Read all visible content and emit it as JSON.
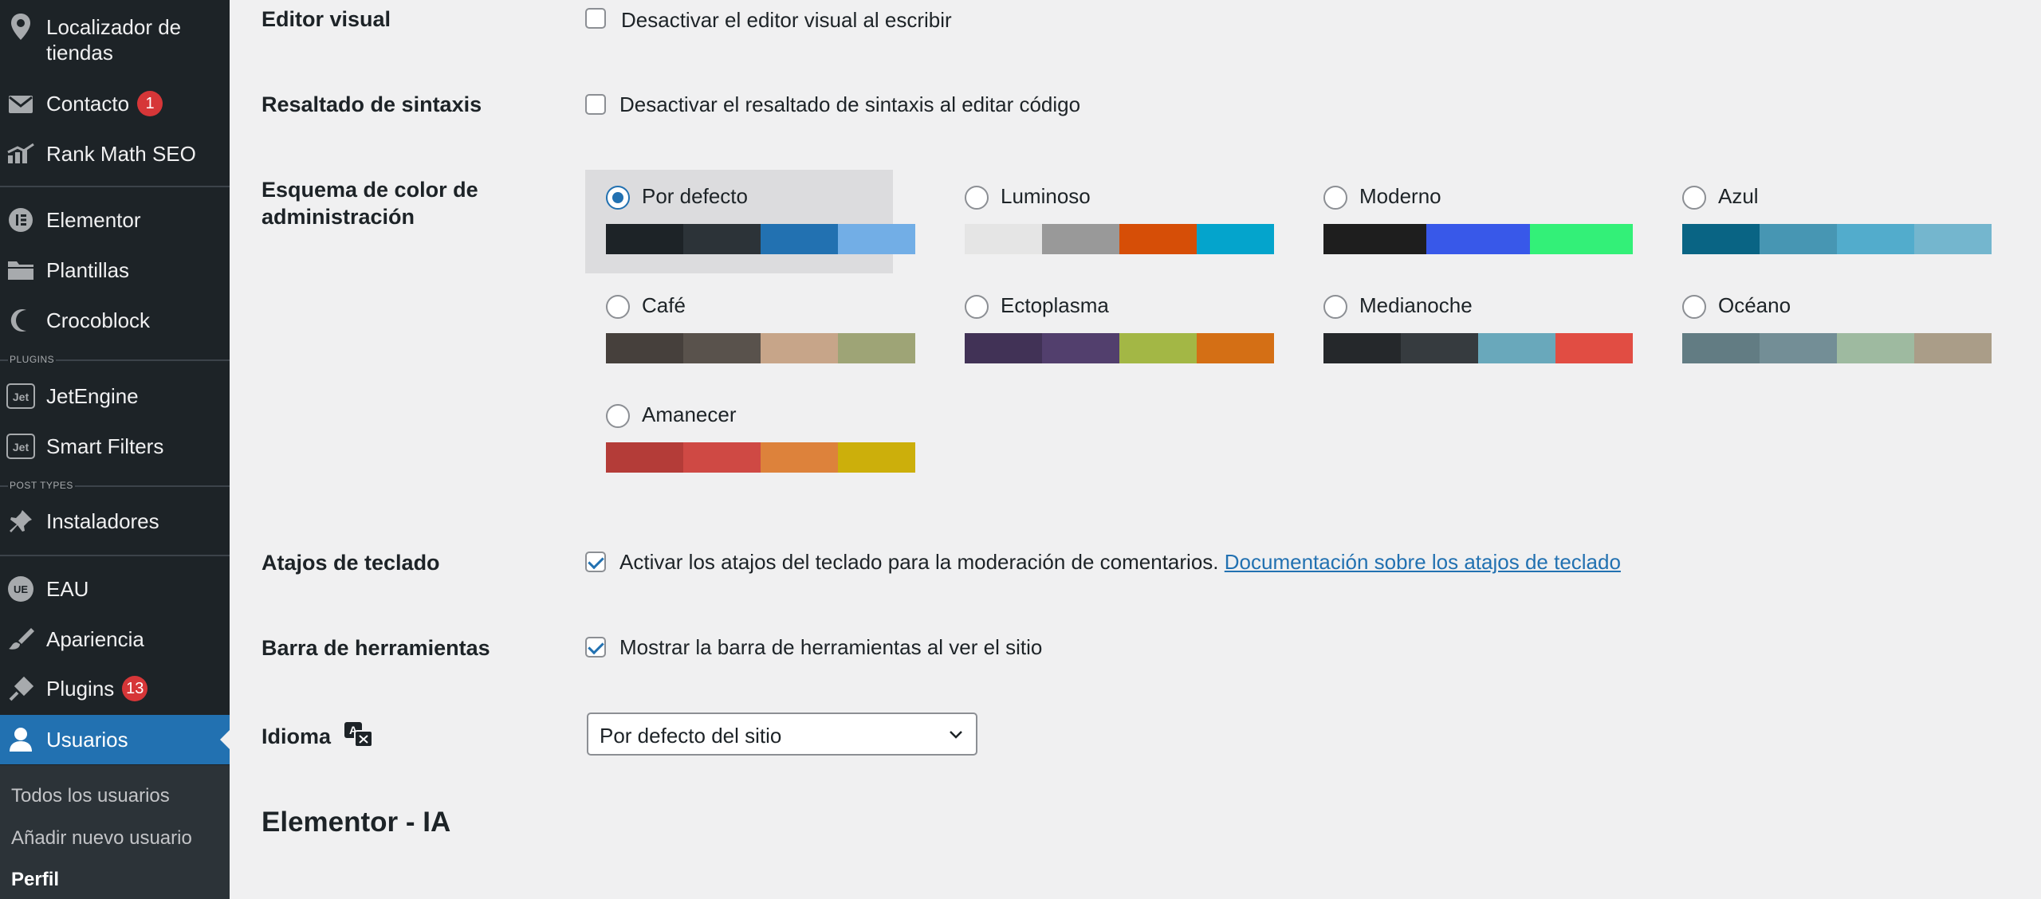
{
  "sidebar": {
    "items": [
      {
        "label": "Localizador de tiendas",
        "icon": "map-pin-icon"
      },
      {
        "label": "Contacto",
        "icon": "mail-icon",
        "badge": "1"
      },
      {
        "label": "Rank Math SEO",
        "icon": "chart-icon"
      },
      {
        "label": "Elementor",
        "icon": "elementor-icon"
      },
      {
        "label": "Plantillas",
        "icon": "folder-icon"
      },
      {
        "label": "Crocoblock",
        "icon": "crocoblock-icon"
      },
      {
        "label": "JetEngine",
        "icon": "jet-icon"
      },
      {
        "label": "Smart Filters",
        "icon": "jet-icon"
      },
      {
        "label": "Instaladores",
        "icon": "pin-icon"
      },
      {
        "label": "EAU",
        "icon": "eau-icon"
      },
      {
        "label": "Apariencia",
        "icon": "brush-icon"
      },
      {
        "label": "Plugins",
        "icon": "plug-icon",
        "badge": "13"
      },
      {
        "label": "Usuarios",
        "icon": "user-icon",
        "active": true
      }
    ],
    "section_plugins": "PLUGINS",
    "section_post_types": "POST TYPES",
    "submenu": [
      "Todos los usuarios",
      "Añadir nuevo usuario",
      "Perfil"
    ]
  },
  "settings": {
    "visual_editor": {
      "label": "Editor visual",
      "option": "Desactivar el editor visual al escribir",
      "checked": false
    },
    "syntax": {
      "label": "Resaltado de sintaxis",
      "option": "Desactivar el resaltado de sintaxis al editar código",
      "checked": false
    },
    "color_scheme": {
      "label": "Esquema de color de administración",
      "schemes": [
        {
          "name": "Por defecto",
          "selected": true,
          "colors": [
            "#1d2327",
            "#2c3338",
            "#2271b1",
            "#72aee6"
          ]
        },
        {
          "name": "Luminoso",
          "colors": [
            "#e5e5e5",
            "#999999",
            "#d64e07",
            "#04a4cc"
          ]
        },
        {
          "name": "Moderno",
          "colors": [
            "#1e1e1e",
            "#3858e9",
            "#33f078"
          ]
        },
        {
          "name": "Azul",
          "colors": [
            "#096484",
            "#4796b3",
            "#52accc",
            "#74b6ce"
          ]
        },
        {
          "name": "Café",
          "colors": [
            "#46403c",
            "#59524c",
            "#c7a589",
            "#9ea476"
          ]
        },
        {
          "name": "Ectoplasma",
          "colors": [
            "#413256",
            "#523f6d",
            "#a3b745",
            "#d46f15"
          ]
        },
        {
          "name": "Medianoche",
          "colors": [
            "#25282b",
            "#363b3f",
            "#69a8bb",
            "#e14d43"
          ]
        },
        {
          "name": "Océano",
          "colors": [
            "#627c83",
            "#738e96",
            "#9ebaa0",
            "#aa9d88"
          ]
        },
        {
          "name": "Amanecer",
          "colors": [
            "#b43c38",
            "#cf4944",
            "#dd823b",
            "#ccaf0b"
          ]
        }
      ]
    },
    "keyboard": {
      "label": "Atajos de teclado",
      "option": "Activar los atajos del teclado para la moderación de comentarios.",
      "link": "Documentación sobre los atajos de teclado",
      "checked": true
    },
    "toolbar": {
      "label": "Barra de herramientas",
      "option": "Mostrar la barra de herramientas al ver el sitio",
      "checked": true
    },
    "language": {
      "label": "Idioma",
      "value": "Por defecto del sitio"
    }
  },
  "section_title": "Elementor - IA"
}
